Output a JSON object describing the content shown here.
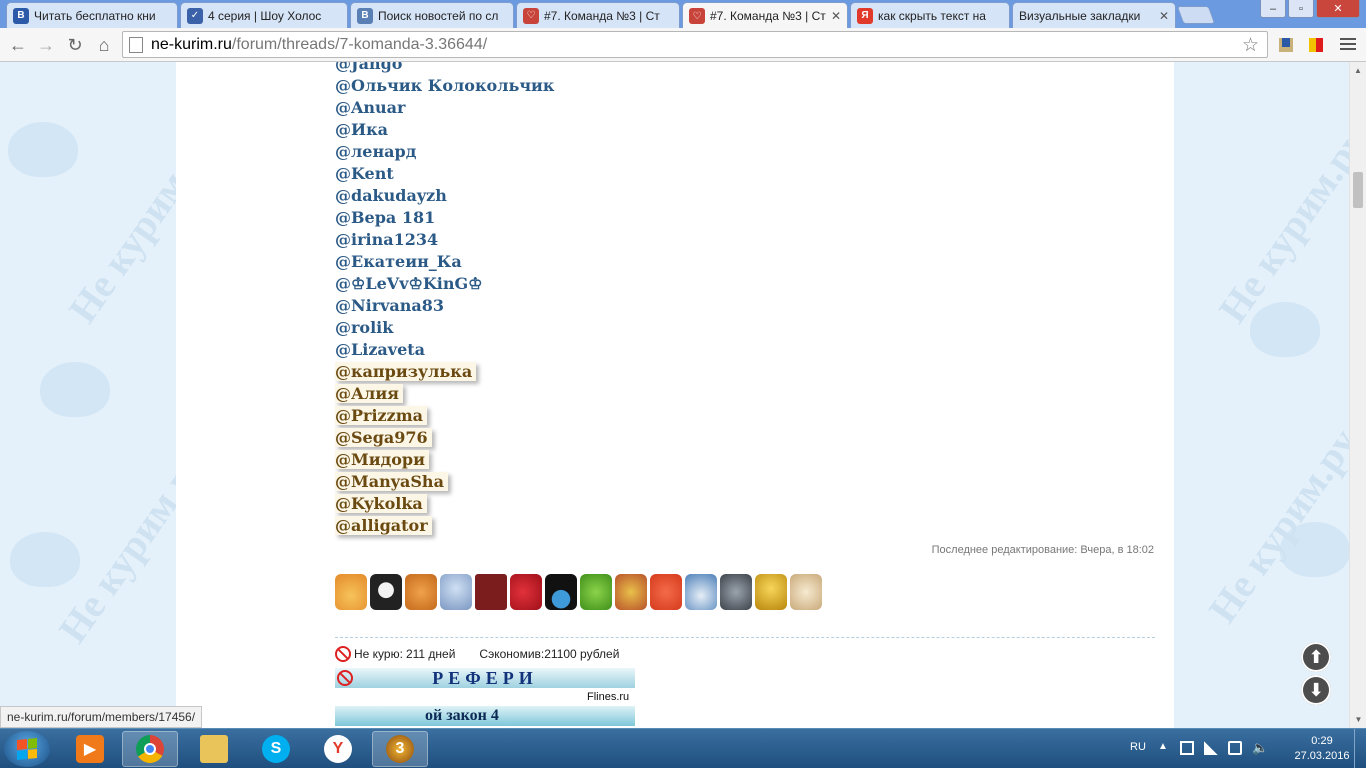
{
  "browser": {
    "tabs": [
      {
        "title": "Читать бесплатно кни",
        "favicon": "B",
        "favicon_color": "#2b5aa8"
      },
      {
        "title": "4 серия | Шоу Холос",
        "favicon": "✓",
        "favicon_color": "#3b62a9"
      },
      {
        "title": "Поиск новостей по сл",
        "favicon": "В",
        "favicon_color": "#5a7fb5"
      },
      {
        "title": "#7. Команда №3 | Ст",
        "favicon": "♡",
        "favicon_color": "#c8443b"
      },
      {
        "title": "#7. Команда №3 | Ст",
        "favicon": "♡",
        "favicon_color": "#c8443b"
      },
      {
        "title": "как скрыть текст на",
        "favicon": "Я",
        "favicon_color": "#e23a2a"
      },
      {
        "title": "Визуальные закладки",
        "favicon": "",
        "favicon_color": ""
      }
    ],
    "active_tab_index": 4,
    "url_host": "ne-kurim.ru",
    "url_path": "/forum/threads/7-komanda-3.36644/",
    "window_buttons": {
      "minimize": "–",
      "maximize": "▫",
      "close": "✕"
    }
  },
  "post": {
    "mentions": [
      "@Jango",
      "@Ольчик Колокольчик",
      "@Anuar",
      "@Ика",
      "@ленард",
      "@Kent",
      "@dakudayzh",
      "@Вера 181",
      "@irina1234",
      "@Екатеин_Ка",
      "@♔LeVv♔KinG♔",
      "@Nirvana83",
      "@rolik",
      "@Lizaveta"
    ],
    "highlighted_mentions": [
      "@капризулька",
      "@Алия",
      "@Prizzma",
      "@Sega976",
      "@Мидори",
      "@ManyaSha",
      "@Kykolka",
      "@alligator"
    ],
    "edited_note": "Последнее редактирование: Вчера, в 18:02",
    "award_icons": [
      "cake-icon",
      "penguins-icon",
      "cat-icon",
      "snowman-icon",
      "passport-icon",
      "hearts-icon",
      "black-cat-icon",
      "butterfly-icon",
      "bouquet-icon",
      "flowers-icon",
      "sneaker-icon",
      "skate-icon",
      "trophy-icon",
      "scroll-icon"
    ]
  },
  "signature": {
    "not_smoking_label": "Не курю:",
    "not_smoking_value": "211 дней",
    "saved_label": "Сэкономив:",
    "saved_value": "21100 рублей",
    "banner_title": "РЕФЕРИ",
    "banner_source": "Flines.ru",
    "banner2_text": "ой закон 4"
  },
  "status_bar": "ne-kurim.ru/forum/members/17456/",
  "taskbar": {
    "language": "RU",
    "time": "0:29",
    "date": "27.03.2016"
  }
}
